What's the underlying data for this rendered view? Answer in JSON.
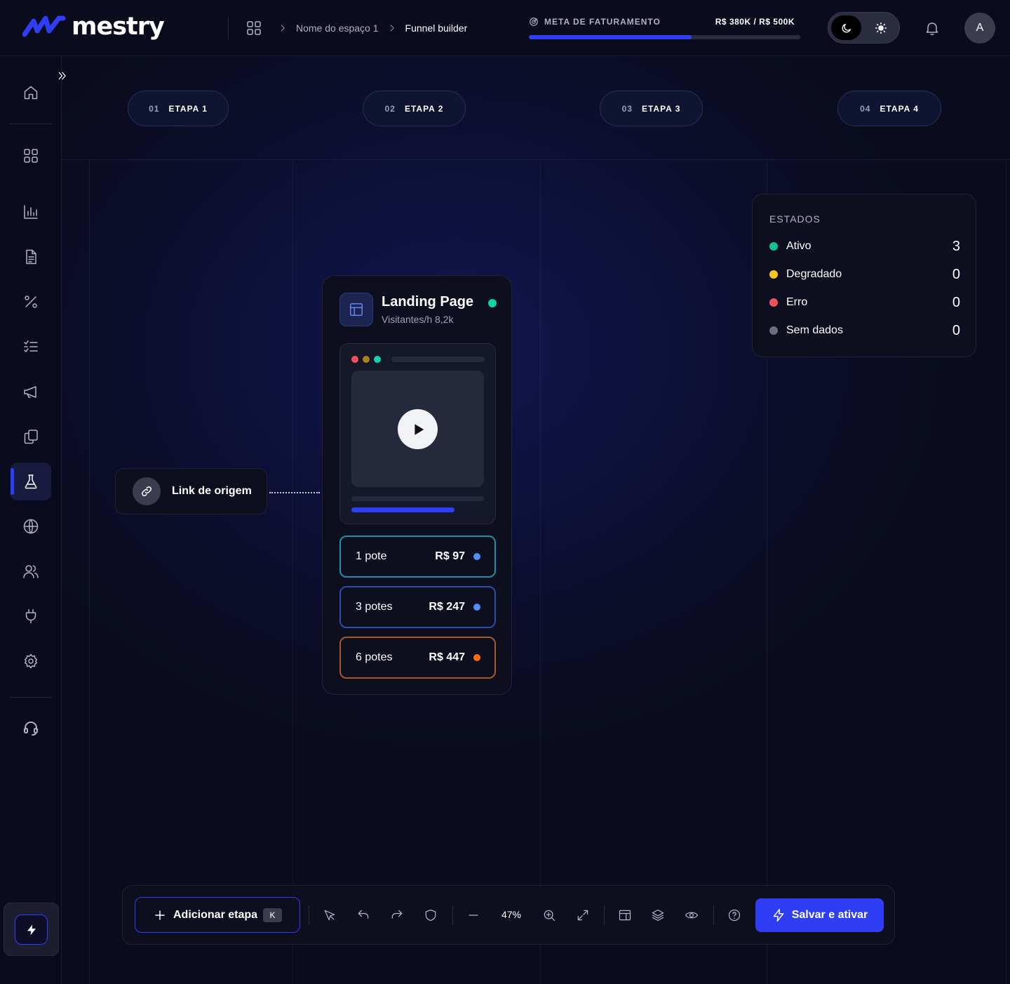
{
  "brand": {
    "name": "mestry",
    "accent": "#2d3ef5"
  },
  "breadcrumb": {
    "icon": "grid-icon",
    "items": [
      "Nome do espaço 1",
      "Funnel builder"
    ]
  },
  "revenue_goal": {
    "label": "META DE FATURAMENTO",
    "value": "R$ 380K / R$ 500K",
    "progress": 0.6
  },
  "theme_toggle": {
    "options": [
      "moon-icon",
      "sun-icon"
    ],
    "selected": "dark"
  },
  "header": {
    "avatar_initial": "A",
    "notifications_icon": "bell-icon"
  },
  "sidebar": {
    "items": [
      {
        "icon": "home-icon"
      },
      {
        "icon": "dashboard-icon"
      },
      {
        "icon": "bar-chart-icon"
      },
      {
        "icon": "document-icon"
      },
      {
        "icon": "percent-icon"
      },
      {
        "icon": "checklist-icon"
      },
      {
        "icon": "megaphone-icon"
      },
      {
        "icon": "copy-icon"
      },
      {
        "icon": "flask-icon",
        "active": true
      },
      {
        "icon": "globe-icon"
      },
      {
        "icon": "users-icon"
      },
      {
        "icon": "plug-icon"
      },
      {
        "icon": "settings-icon"
      },
      {
        "icon": "headset-icon"
      }
    ],
    "bottom_action": "bolt-icon"
  },
  "stages": [
    {
      "num": "01",
      "name": "ETAPA 1"
    },
    {
      "num": "02",
      "name": "ETAPA 2"
    },
    {
      "num": "03",
      "name": "ETAPA 3"
    },
    {
      "num": "04",
      "name": "ETAPA 4"
    }
  ],
  "source_node": {
    "label": "Link de origem",
    "icon": "link-icon"
  },
  "landing_page": {
    "title": "Landing Page",
    "subtitle": "Visitantes/h 8,2k",
    "status_color": "#12d39b",
    "video_progress": 0.78,
    "offers": [
      {
        "name": "1 pote",
        "price": "R$ 97",
        "border": "#1f8fa8",
        "dot": "#4f8ff7"
      },
      {
        "name": "3 potes",
        "price": "R$ 247",
        "border": "#2a4db0",
        "dot": "#4f8ff7"
      },
      {
        "name": "6 potes",
        "price": "R$ 447",
        "border": "#a8572a",
        "dot": "#ff6a13"
      }
    ]
  },
  "states": {
    "title": "ESTADOS",
    "rows": [
      {
        "label": "Ativo",
        "count": "3",
        "color": "#12c48a"
      },
      {
        "label": "Degradado",
        "count": "0",
        "color": "#f5c518"
      },
      {
        "label": "Erro",
        "count": "0",
        "color": "#f0515d"
      },
      {
        "label": "Sem dados",
        "count": "0",
        "color": "#6b6e80"
      }
    ]
  },
  "toolbar": {
    "add_label": "Adicionar etapa",
    "add_shortcut": "K",
    "zoom": "47%",
    "save_label": "Salvar e ativar"
  }
}
